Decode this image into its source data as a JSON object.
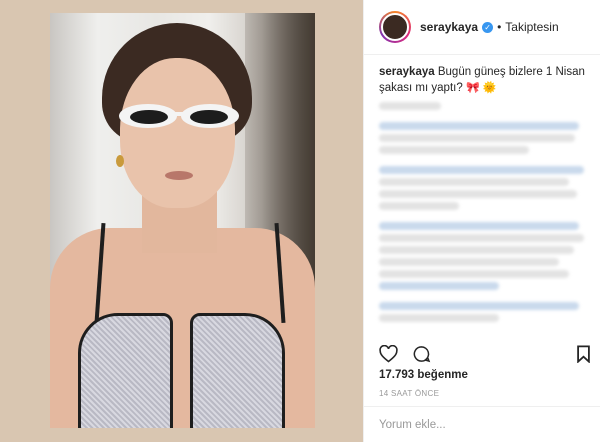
{
  "header": {
    "username": "seraykaya",
    "verified": true,
    "follow_status": "Takiptesin"
  },
  "caption": {
    "username": "seraykaya",
    "text": "Bugün güneş bizlere 1 Nisan şakası mı yaptı?"
  },
  "stats": {
    "likes": "17.793 beğenme",
    "time": "14 SAAT ÖNCE"
  },
  "comment": {
    "placeholder": "Yorum ekle..."
  },
  "icons": {
    "like": "heart-icon",
    "comment": "comment-icon",
    "save": "bookmark-icon",
    "verified": "verified-badge-icon"
  },
  "colors": {
    "accent_blue": "#3897f0",
    "text": "#262626",
    "muted": "#999999",
    "background_panel": "#d9c6b1"
  }
}
